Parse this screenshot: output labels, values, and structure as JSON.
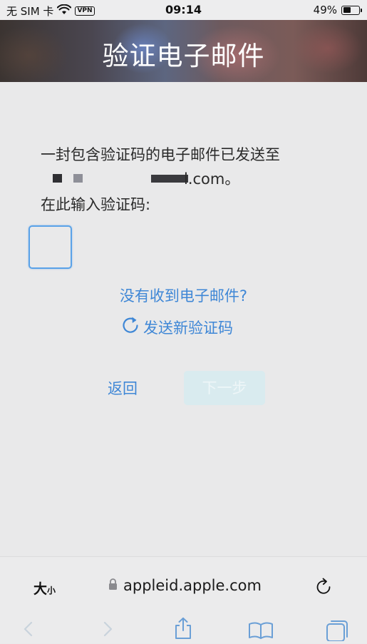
{
  "status_bar": {
    "carrier": "无 SIM 卡",
    "vpn": "VPN",
    "time": "09:14",
    "battery": "49%",
    "battery_level": 0.49
  },
  "header": {
    "title": "验证电子邮件"
  },
  "main": {
    "intro": "一封包含验证码的电子邮件已发送至",
    "email_suffix": "l.com。",
    "prompt": "在此输入验证码:",
    "code_value": "",
    "no_email": "没有收到电子邮件?",
    "resend": "发送新验证码",
    "back": "返回",
    "next": "下一步"
  },
  "browser": {
    "text_size_big": "大",
    "text_size_small": "小",
    "url": "appleid.apple.com"
  },
  "colors": {
    "link": "#3f87d6",
    "focus_border": "#5aa2e8",
    "disabled_button": "#d9ebef"
  }
}
